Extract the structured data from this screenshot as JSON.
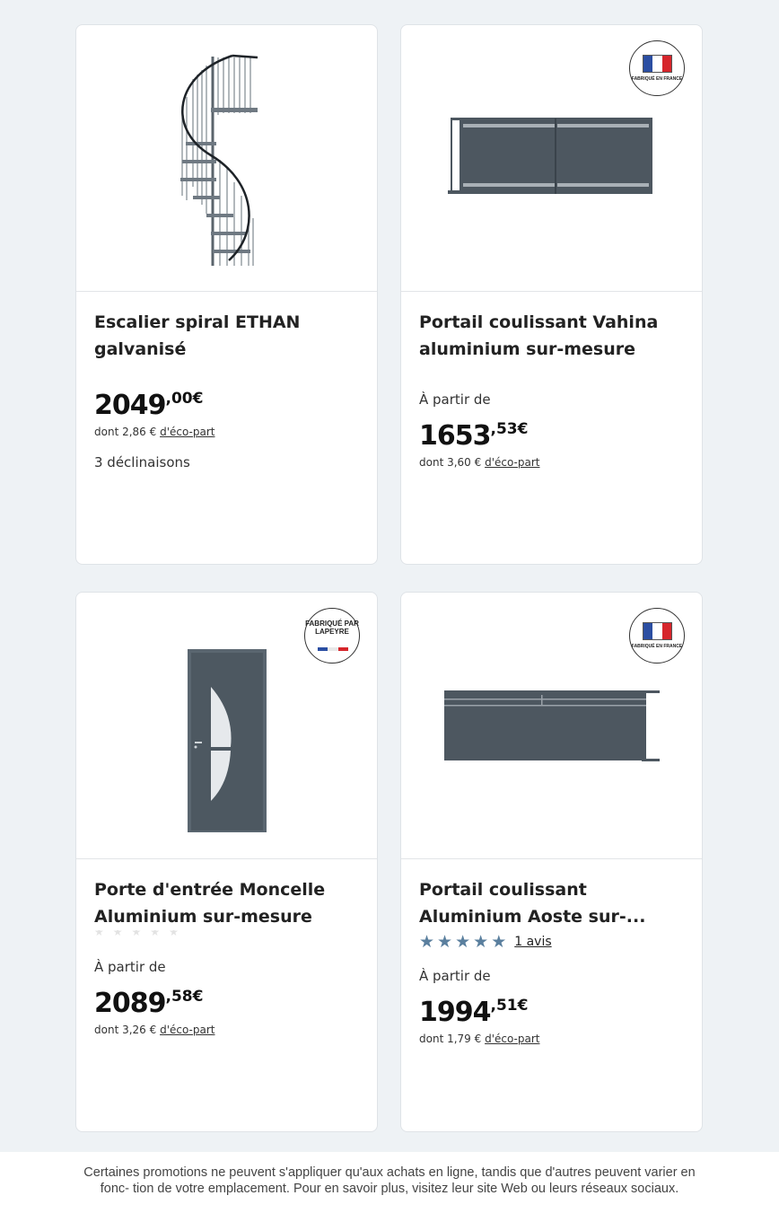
{
  "products": [
    {
      "title": "Escalier spiral ETHAN galvanisé",
      "price_int": "2049",
      "price_dec": ",00€",
      "eco_prefix": "dont 2,86 € ",
      "eco_link": "d'éco-part",
      "variants": "3 déclinaisons",
      "image": "spiral-staircase"
    },
    {
      "title": "Portail coulissant Vahina aluminium sur-mesure",
      "badge_text": "FABRIQUÉ EN FRANCE",
      "from_label": "À partir de",
      "price_int": "1653",
      "price_dec": ",53€",
      "eco_prefix": "dont 3,60 € ",
      "eco_link": "d'éco-part",
      "image": "sliding-gate"
    },
    {
      "title": "Porte d'entrée Moncelle Aluminium sur-mesure",
      "badge_text": "FABRIQUÉ PAR LAPEYRE",
      "from_label": "À partir de",
      "price_int": "2089",
      "price_dec": ",58€",
      "eco_prefix": "dont 3,26 € ",
      "eco_link": "d'éco-part",
      "image": "entry-door"
    },
    {
      "title": "Portail coulissant Aluminium Aoste sur-...",
      "badge_text": "FABRIQUÉ EN FRANCE",
      "rating": 5,
      "reviews": "1 avis",
      "from_label": "À partir de",
      "price_int": "1994",
      "price_dec": ",51€",
      "eco_prefix": "dont 1,79 € ",
      "eco_link": "d'éco-part",
      "image": "sliding-gate"
    }
  ],
  "footer": {
    "text": "Certaines promotions ne peuvent s'appliquer qu'aux achats en ligne, tandis que d'autres peuvent varier en fonc- tion de votre emplacement. Pour en savoir plus, visitez leur site Web ou leurs réseaux sociaux."
  },
  "colors": {
    "background": "#eef2f5",
    "star": "#5a7f9e",
    "product_gray": "#4d5760",
    "flag_blue": "#2b4ea2",
    "flag_red": "#d6252b"
  }
}
